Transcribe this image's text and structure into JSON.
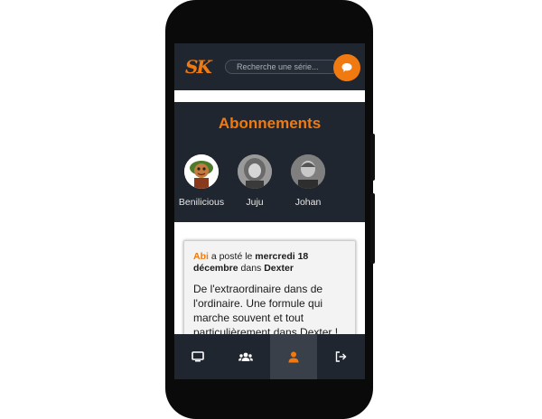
{
  "header": {
    "logo_text": "SK",
    "search_placeholder": "Recherche une série..."
  },
  "subscriptions": {
    "title": "Abonnements",
    "items": [
      {
        "name": "Benilicious"
      },
      {
        "name": "Juju"
      },
      {
        "name": "Johan"
      }
    ]
  },
  "feed": {
    "post": {
      "user": "Abi",
      "text_posted": " a posté le ",
      "date": "mercredi 18 décembre",
      "text_in": " dans ",
      "show": "Dexter",
      "comment": "De l'extraordinaire dans de l'ordinaire. Une formule qui marche souvent et tout particulièrement dans Dexter !"
    }
  },
  "bottom_nav": {
    "items": [
      {
        "icon": "tv-icon",
        "active": false
      },
      {
        "icon": "users-icon",
        "active": false
      },
      {
        "icon": "user-icon",
        "active": true
      },
      {
        "icon": "logout-icon",
        "active": false
      }
    ]
  },
  "colors": {
    "accent": "#f07a10",
    "dark_bg": "#1f2630",
    "active_nav": "#3a404a"
  }
}
